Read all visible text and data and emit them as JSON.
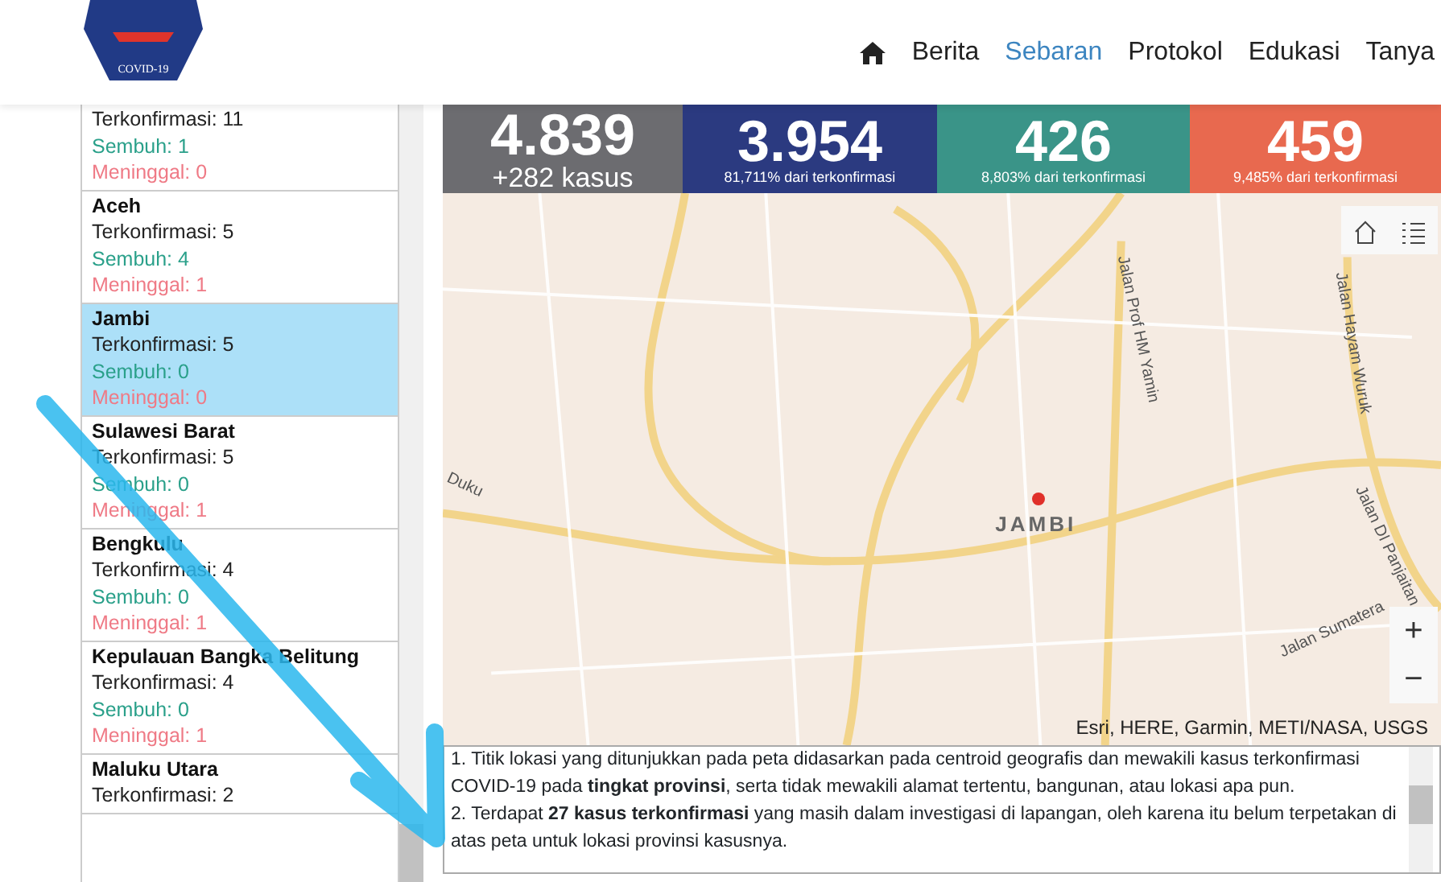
{
  "header": {
    "logo_text": "COVID-19",
    "nav": [
      {
        "label": "Berita",
        "selected": false
      },
      {
        "label": "Sebaran",
        "selected": true
      },
      {
        "label": "Protokol",
        "selected": false
      },
      {
        "label": "Edukasi",
        "selected": false
      },
      {
        "label": "Tanya",
        "selected": false
      }
    ]
  },
  "provinces": [
    {
      "confirmed": "Terkonfirmasi: 11",
      "recovered": "Sembuh: 1",
      "deaths": "Meninggal: 0",
      "selected": false
    },
    {
      "name": "Aceh",
      "confirmed": "Terkonfirmasi: 5",
      "recovered": "Sembuh: 4",
      "deaths": "Meninggal: 1",
      "selected": false
    },
    {
      "name": "Jambi",
      "confirmed": "Terkonfirmasi: 5",
      "recovered": "Sembuh: 0",
      "deaths": "Meninggal: 0",
      "selected": true
    },
    {
      "name": "Sulawesi Barat",
      "confirmed": "Terkonfirmasi: 5",
      "recovered": "Sembuh: 0",
      "deaths": "Meninggal: 1",
      "selected": false
    },
    {
      "name": "Bengkulu",
      "confirmed": "Terkonfirmasi: 4",
      "recovered": "Sembuh: 0",
      "deaths": "Meninggal: 1",
      "selected": false
    },
    {
      "name": "Kepulauan Bangka Belitung",
      "confirmed": "Terkonfirmasi: 4",
      "recovered": "Sembuh: 0",
      "deaths": "Meninggal: 1",
      "selected": false
    },
    {
      "name": "Maluku Utara",
      "confirmed": "Terkonfirmasi: 2",
      "selected": false
    }
  ],
  "stats": [
    {
      "value": "4.839",
      "note": "+282 kasus",
      "color": "#6c6c70"
    },
    {
      "value": "3.954",
      "note": "81,711% dari terkonfirmasi",
      "color": "#2b3a80"
    },
    {
      "value": "426",
      "note": "8,803% dari terkonfirmasi",
      "color": "#3a9488"
    },
    {
      "value": "459",
      "note": "9,485% dari terkonfirmasi",
      "color": "#e8694f"
    }
  ],
  "map": {
    "city": "JAMBI",
    "roads": [
      "Jalan Prof HM Yamin",
      "Jalan Hayam Wuruk",
      "Duku",
      "Jalan Sumatera",
      "Jalan DI Panjaitan"
    ],
    "attribution": "Esri, HERE, Garmin, METI/NASA, USGS",
    "zoom_in": "+",
    "zoom_out": "−"
  },
  "notes": [
    "1. Titik lokasi yang ditunjukkan pada peta didasarkan pada centroid geografis dan mewakili kasus terkonfirmasi COVID-19 pada **tingkat provinsi**, serta tidak mewakili alamat tertentu, bangunan, atau lokasi apa pun.",
    "2. Terdapat **27 kasus terkonfirmasi** yang masih dalam investigasi di lapangan, oleh karena itu belum terpetakan di atas peta untuk lokasi provinsi kasusnya."
  ]
}
